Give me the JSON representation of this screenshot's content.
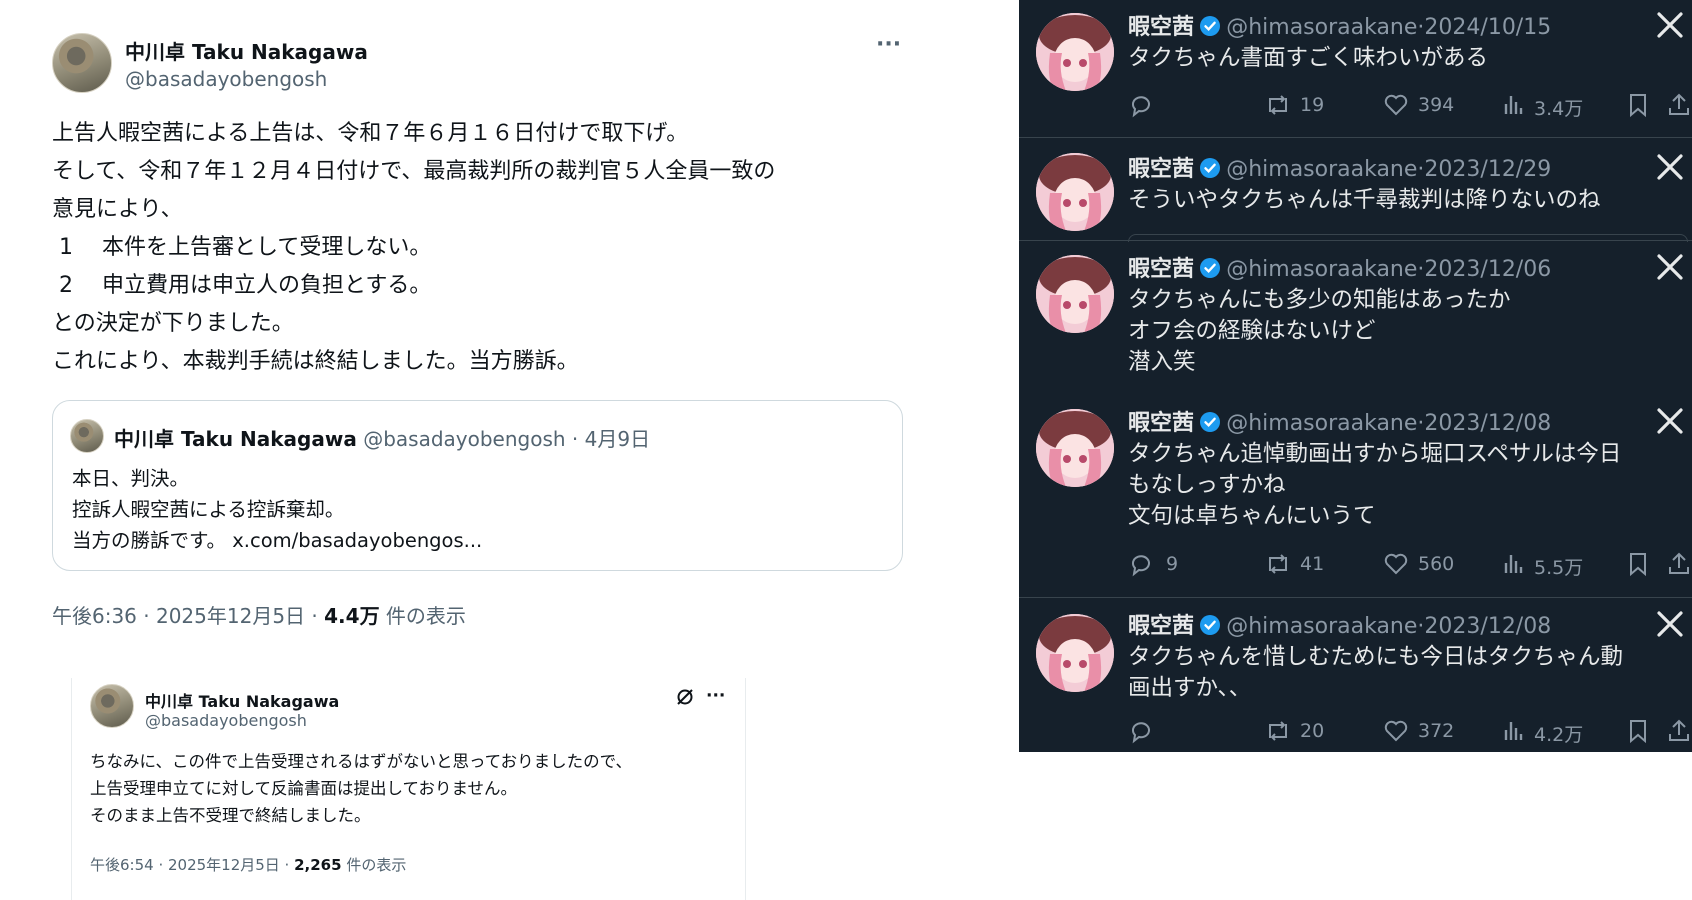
{
  "main_tweet": {
    "author_name": "中川卓 Taku Nakagawa",
    "author_handle": "@basadayobengosh",
    "more_label": "···",
    "body_lines": [
      "上告人暇空茜による上告は、令和７年６月１６日付けで取下げ。",
      "そして、令和７年１２月４日付けで、最高裁判所の裁判官５人全員一致の",
      "意見により、",
      " 1 　本件を上告審として受理しない。",
      " 2 　申立費用は申立人の負担とする。",
      "との決定が下りました。",
      "これにより、本裁判手続は終結しました。当方勝訴。"
    ],
    "quote": {
      "author_name": "中川卓 Taku Nakagawa",
      "author_handle": "@basadayobengosh",
      "date": "· 4月9日",
      "lines": [
        "本日、判決。",
        "控訴人暇空茜による控訴棄却。",
        "当方の勝訴です。 x.com/basadayobengos..."
      ]
    },
    "meta_time": "午後6:36 · 2025年12月5日 · ",
    "meta_views": "4.4万",
    "meta_views_suffix": " 件の表示"
  },
  "second_tweet": {
    "author_name": "中川卓 Taku Nakagawa",
    "author_handle": "@basadayobengosh",
    "more_label": "···",
    "lines": [
      "ちなみに、この件で上告受理されるはずがないと思っておりましたので、",
      "上告受理申立てに対して反論書面は提出しておりません。",
      "そのまま上告不受理で終結しました。"
    ],
    "meta_time": "午後6:54 · 2025年12月5日 · ",
    "meta_views": "2,265",
    "meta_views_suffix": " 件の表示"
  },
  "dark_panel": {
    "colors": {
      "background": "#15202b",
      "text": "#e7e9ea",
      "muted": "#8b98a5",
      "verified": "#1d9bf0"
    },
    "posts": [
      {
        "name": "暇空茜",
        "handle": "@himasoraakane",
        "date": "·2024/10/15",
        "lines": [
          "タクちゃん書面すごく味わいがある"
        ],
        "stats": {
          "replies": "",
          "reposts": "19",
          "likes": "394",
          "views": "3.4万"
        }
      },
      {
        "name": "暇空茜",
        "handle": "@himasoraakane",
        "date": "·2023/12/29",
        "lines": [
          "そういやタクちゃんは千尋裁判は降りないのね"
        ],
        "stats": null
      },
      {
        "name": "暇空茜",
        "handle": "@himasoraakane",
        "date": "·2023/12/06",
        "lines": [
          "タクちゃんにも多少の知能はあったか",
          "オフ会の経験はないけど",
          "潜入笑"
        ],
        "stats": null
      },
      {
        "name": "暇空茜",
        "handle": "@himasoraakane",
        "date": "·2023/12/08",
        "lines": [
          "タクちゃん追悼動画出すから堀口スペサルは今日",
          "もなしっすかね",
          "文句は卓ちゃんにいうて"
        ],
        "stats": {
          "replies": "9",
          "reposts": "41",
          "likes": "560",
          "views": "5.5万"
        }
      },
      {
        "name": "暇空茜",
        "handle": "@himasoraakane",
        "date": "·2023/12/08",
        "lines": [
          "タクちゃんを惜しむためにも今日はタクちゃん動",
          "画出すか、、"
        ],
        "stats": {
          "replies": "",
          "reposts": "20",
          "likes": "372",
          "views": "4.2万"
        }
      }
    ]
  }
}
